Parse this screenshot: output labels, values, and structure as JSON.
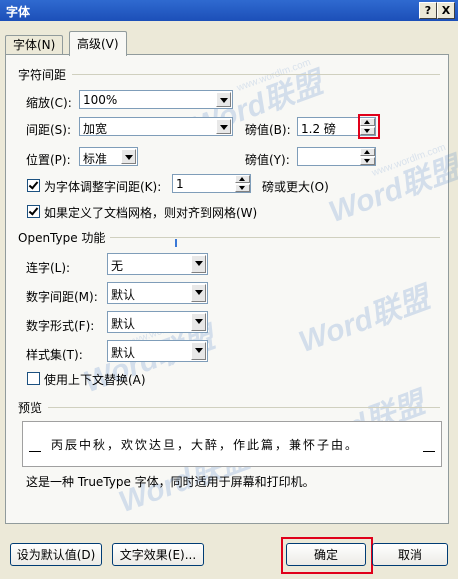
{
  "window": {
    "title": "字体",
    "help_label": "?",
    "close_label": "X"
  },
  "tabs": [
    {
      "label": "字体(N)",
      "active": false
    },
    {
      "label": "高级(V)",
      "active": true
    }
  ],
  "char_spacing": {
    "section_title": "字符间距",
    "scale": {
      "label": "缩放(C):",
      "value": "100%"
    },
    "spacing": {
      "label": "间距(S):",
      "value": "加宽",
      "pt_label": "磅值(B):",
      "pt_value": "1.2 磅"
    },
    "position": {
      "label": "位置(P):",
      "value": "标准",
      "pt_label": "磅值(Y):",
      "pt_value": ""
    },
    "kerning": {
      "label": "为字体调整字间距(K):",
      "checked": true,
      "value": "1",
      "suffix": "磅或更大(O)"
    },
    "snap_grid": {
      "label": "如果定义了文档网格，则对齐到网格(W)",
      "checked": true
    }
  },
  "opentype": {
    "section_title": "OpenType 功能",
    "ligatures": {
      "label": "连字(L):",
      "value": "无"
    },
    "number_spacing": {
      "label": "数字间距(M):",
      "value": "默认"
    },
    "number_forms": {
      "label": "数字形式(F):",
      "value": "默认"
    },
    "stylistic_sets": {
      "label": "样式集(T):",
      "value": "默认"
    },
    "contextual_alternates": {
      "label": "使用上下文替换(A)",
      "checked": false
    }
  },
  "preview": {
    "section_title": "预览",
    "sample_text": "丙辰中秋，欢饮达旦，大醉，作此篇，兼怀子由。",
    "description": "这是一种 TrueType 字体，同时适用于屏幕和打印机。"
  },
  "buttons": {
    "set_default": "设为默认值(D)",
    "text_effects": "文字效果(E)...",
    "ok": "确定",
    "cancel": "取消"
  },
  "watermark": {
    "text": "Word联盟",
    "url": "www.wordlm.com"
  },
  "colors": {
    "highlight": "#e0001a",
    "title_bar": "#2f6ad0"
  }
}
